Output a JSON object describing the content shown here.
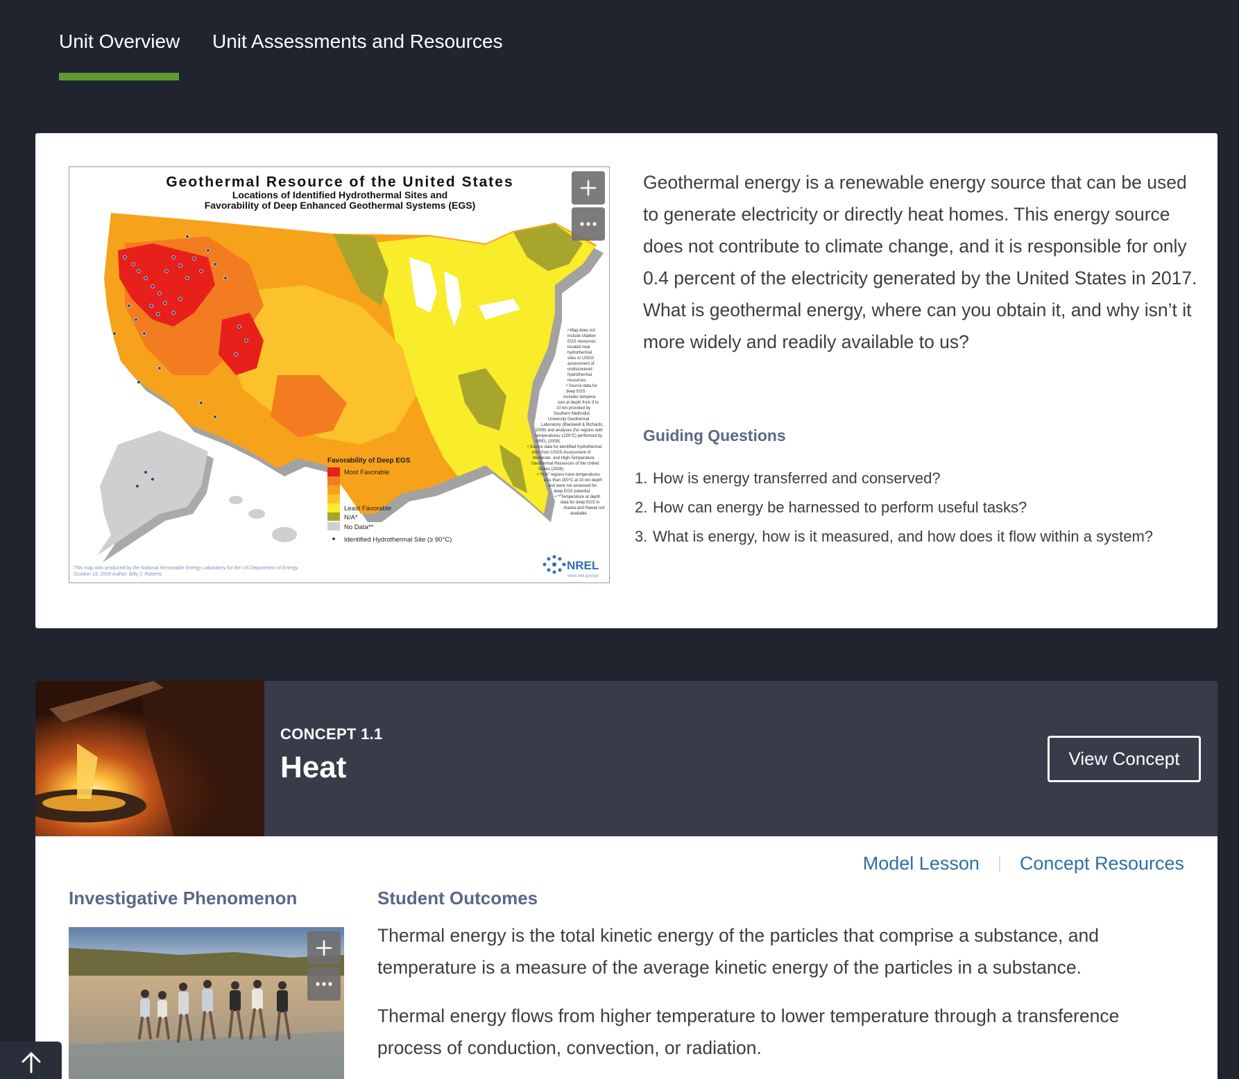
{
  "tabs": [
    {
      "label": "Unit Overview",
      "active": true
    },
    {
      "label": "Unit Assessments and Resources",
      "active": false
    }
  ],
  "colors": {
    "page_bg": "#20242f",
    "tab_active_underline": "#5f9b2f",
    "concept_header_bg": "#383c4a",
    "heading_blue_gray": "#5a6789",
    "link_blue": "#2f6fa7"
  },
  "intro": {
    "map": {
      "title": "Geothermal Resource of the United States",
      "subtitle_1": "Locations of Identified Hydrothermal Sites and",
      "subtitle_2": "Favorability of Deep Enhanced Geothermal Systems (EGS)",
      "legend_title": "Favorability of Deep EGS",
      "legend_most": "Most Favorable",
      "legend_least": "Least Favorable",
      "legend_na": "N/A*",
      "legend_nodata": "No Data**",
      "legend_site": "Identified Hydrothermal Site (≥ 90°C)",
      "credit_1": "This map was produced by the National Renewable Energy Laboratory for the US Department of Energy.",
      "credit_2": "October 13, 2009 Author: Billy J. Roberts",
      "logo_text": "NREL",
      "logo_sub": "www.nrel.gov/gis",
      "footnote_1": "• Map does not",
      "footnote_2": "include shallow",
      "footnote_3": "EGS resources",
      "footnote_4": "located near",
      "footnote_5": "hydrothermal",
      "footnote_6": "sites or USGS",
      "footnote_7": "assessment of",
      "footnote_8": "undiscovered",
      "footnote_9": "hydrothermal",
      "footnote_10": "resources.",
      "footnote_11": "• Source data for",
      "footnote_12": "deep EGS",
      "footnote_13": "includes tempera-",
      "footnote_14": "ture at depth from 3 to",
      "footnote_15": "10 km provided by",
      "footnote_16": "Southern Methodist",
      "footnote_17": "University Geothermal",
      "footnote_18": "Laboratory (Blackwell & Richards,",
      "footnote_19": "2009) and analyses (for regions with",
      "footnote_20": "temperatures ≥150°C) performed by",
      "footnote_21": "NREL (2009).",
      "footnote_22": "• Source data for identified hydrothermal",
      "footnote_23": "sites from USGS Assessment of",
      "footnote_24": "Moderate- and High-Temperature",
      "footnote_25": "Geothermal Resources of the United",
      "footnote_26": "States (2008).",
      "footnote_27": "• \"N/A\" regions have temperatures",
      "footnote_28": "less than 150°C at 10 km depth",
      "footnote_29": "and were not assessed for",
      "footnote_30": "deep EGS potential.",
      "footnote_31": "• **Temperature at depth",
      "footnote_32": "data for deep EGS in",
      "footnote_33": "Alaska and Hawaii not",
      "footnote_34": "available."
    },
    "zoom_icon": "plus-icon",
    "more_icon": "ellipsis-icon",
    "description": "Geothermal energy is a renewable energy source that can be used to generate electricity or directly heat homes. This energy source does not contribute to climate change, and it is responsible for only 0.4 percent of the electricity generated by the United States in 2017. What is geothermal energy, where can you obtain it, and why isn’t it more widely and readily available to us?",
    "guiding_title": "Guiding Questions",
    "guiding_questions": [
      {
        "num": "1.",
        "text": "How is energy transferred and conserved?"
      },
      {
        "num": "2.",
        "text": "How can energy be harnessed to perform useful tasks?"
      },
      {
        "num": "3.",
        "text": "What is energy, how is it measured, and how does it flow within a system?"
      }
    ]
  },
  "concept": {
    "label": "CONCEPT 1.1",
    "title": "Heat",
    "view_button": "View Concept",
    "links": {
      "model_lesson": "Model Lesson",
      "concept_resources": "Concept Resources"
    },
    "phenomenon_title": "Investigative Phenomenon",
    "outcomes_title": "Student Outcomes",
    "outcomes": [
      "Thermal energy is the total kinetic energy of the particles that comprise a substance, and temperature is a measure of the average kinetic energy of the particles in a substance.",
      "Thermal energy flows from higher temperature to lower temperature through a  transference process of conduction, convection, or radiation."
    ]
  },
  "back_to_top_icon": "arrow-up-icon"
}
